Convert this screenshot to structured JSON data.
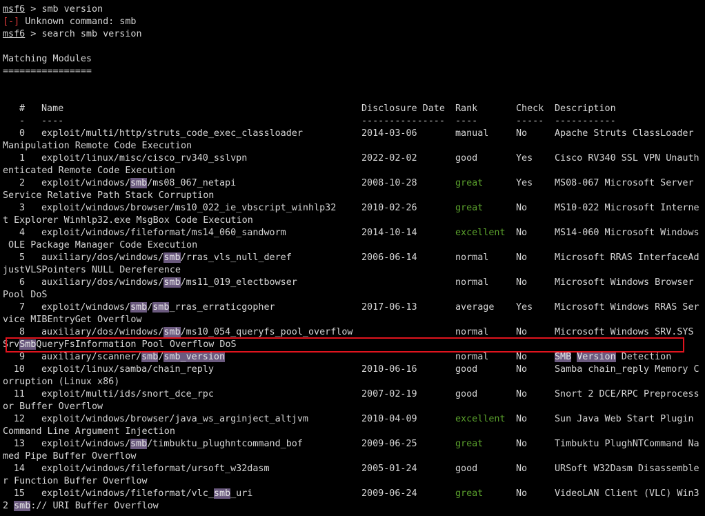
{
  "session": {
    "prompt_label": "msf6",
    "prompt_sep": " > ",
    "cmd1": "smb version",
    "error_tag": "[-]",
    "error_msg": " Unknown command: smb",
    "cmd2": "search smb version"
  },
  "results": {
    "heading": "Matching Modules",
    "underline": "================",
    "headers": {
      "num": "#",
      "name": "Name",
      "date": "Disclosure Date",
      "rank": "Rank",
      "check": "Check",
      "desc": "Description"
    },
    "dashes": {
      "num": "-",
      "name": "----",
      "date": "---------------",
      "rank": "----",
      "check": "-----",
      "desc": "-----------"
    }
  },
  "highlight_term": "smb",
  "rank_colors": {
    "great": "#5aa02c",
    "excellent": "#5aa02c",
    "highlight_bg": "#6b5a7f",
    "selection_box": "#e0141e"
  },
  "modules": [
    {
      "num": "0",
      "name": "exploit/multi/http/struts_code_exec_classloader",
      "date": "2014-03-06",
      "rank": "manual",
      "check": "No",
      "desc": "Apache Struts ClassLoader",
      "desc_wrap": "Manipulation Remote Code Execution"
    },
    {
      "num": "1",
      "name": "exploit/linux/misc/cisco_rv340_sslvpn",
      "date": "2022-02-02",
      "rank": "good",
      "check": "Yes",
      "desc": "Cisco RV340 SSL VPN Unauth",
      "desc_wrap": "enticated Remote Code Execution"
    },
    {
      "num": "2",
      "name": "exploit/windows/smb/ms08_067_netapi",
      "date": "2008-10-28",
      "rank": "great",
      "check": "Yes",
      "desc": "MS08-067 Microsoft Server",
      "desc_wrap": "Service Relative Path Stack Corruption"
    },
    {
      "num": "3",
      "name": "exploit/windows/browser/ms10_022_ie_vbscript_winhlp32",
      "date": "2010-02-26",
      "rank": "great",
      "check": "No",
      "desc": "MS10-022 Microsoft Interne",
      "desc_wrap": "t Explorer Winhlp32.exe MsgBox Code Execution"
    },
    {
      "num": "4",
      "name": "exploit/windows/fileformat/ms14_060_sandworm",
      "date": "2014-10-14",
      "rank": "excellent",
      "check": "No",
      "desc": "MS14-060 Microsoft Windows",
      "desc_wrap": " OLE Package Manager Code Execution"
    },
    {
      "num": "5",
      "name": "auxiliary/dos/windows/smb/rras_vls_null_deref",
      "date": "2006-06-14",
      "rank": "normal",
      "check": "No",
      "desc": "Microsoft RRAS InterfaceAd",
      "desc_wrap": "justVLSPointers NULL Dereference"
    },
    {
      "num": "6",
      "name": "auxiliary/dos/windows/smb/ms11_019_electbowser",
      "date": "",
      "rank": "normal",
      "check": "No",
      "desc": "Microsoft Windows Browser",
      "desc_wrap": "Pool DoS"
    },
    {
      "num": "7",
      "name": "exploit/windows/smb/smb_rras_erraticgopher",
      "date": "2017-06-13",
      "rank": "average",
      "check": "Yes",
      "desc": "Microsoft Windows RRAS Ser",
      "desc_wrap": "vice MIBEntryGet Overflow"
    },
    {
      "num": "8",
      "name": "auxiliary/dos/windows/smb/ms10_054_queryfs_pool_overflow",
      "date": "",
      "rank": "normal",
      "check": "No",
      "desc": "Microsoft Windows SRV.SYS",
      "desc_wrap": "SrvSmbQueryFsInformation Pool Overflow DoS"
    },
    {
      "num": "9",
      "name": "auxiliary/scanner/smb/smb_version",
      "date": "",
      "rank": "normal",
      "check": "No",
      "desc": "SMB Version Detection",
      "desc_wrap": null
    },
    {
      "num": "10",
      "name": "exploit/linux/samba/chain_reply",
      "date": "2010-06-16",
      "rank": "good",
      "check": "No",
      "desc": "Samba chain_reply Memory C",
      "desc_wrap": "orruption (Linux x86)"
    },
    {
      "num": "11",
      "name": "exploit/multi/ids/snort_dce_rpc",
      "date": "2007-02-19",
      "rank": "good",
      "check": "No",
      "desc": "Snort 2 DCE/RPC Preprocess",
      "desc_wrap": "or Buffer Overflow"
    },
    {
      "num": "12",
      "name": "exploit/windows/browser/java_ws_arginject_altjvm",
      "date": "2010-04-09",
      "rank": "excellent",
      "check": "No",
      "desc": "Sun Java Web Start Plugin",
      "desc_wrap": "Command Line Argument Injection"
    },
    {
      "num": "13",
      "name": "exploit/windows/smb/timbuktu_plughntcommand_bof",
      "date": "2009-06-25",
      "rank": "great",
      "check": "No",
      "desc": "Timbuktu PlughNTCommand Na",
      "desc_wrap": "med Pipe Buffer Overflow"
    },
    {
      "num": "14",
      "name": "exploit/windows/fileformat/ursoft_w32dasm",
      "date": "2005-01-24",
      "rank": "good",
      "check": "No",
      "desc": "URSoft W32Dasm Disassemble",
      "desc_wrap": "r Function Buffer Overflow"
    },
    {
      "num": "15",
      "name": "exploit/windows/fileformat/vlc_smb_uri",
      "date": "2009-06-24",
      "rank": "great",
      "check": "No",
      "desc": "VideoLAN Client (VLC) Win3",
      "desc_wrap": "2 smb:// URI Buffer Overflow"
    }
  ]
}
